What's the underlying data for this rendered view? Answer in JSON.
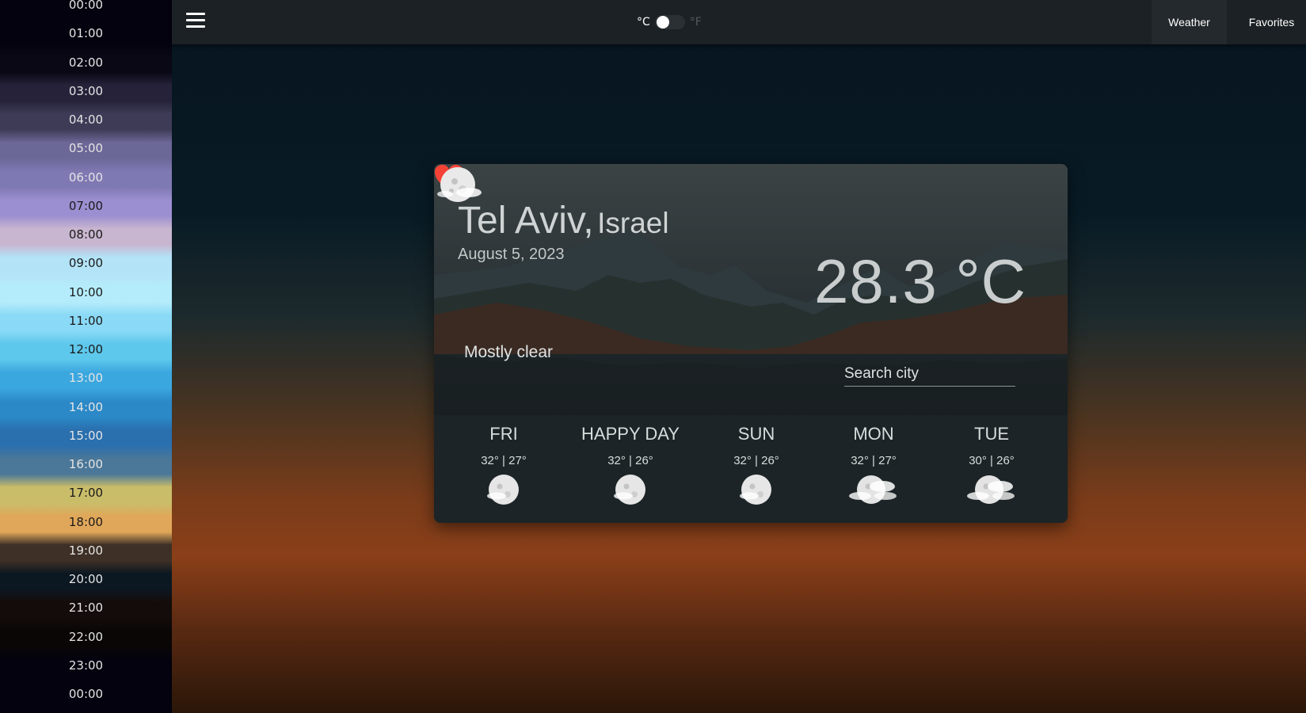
{
  "sidebar": {
    "hours": [
      {
        "label": "00:00",
        "color": "#03020e"
      },
      {
        "label": "01:00",
        "color": "#03020e"
      },
      {
        "label": "02:00",
        "color": "#0a0815"
      },
      {
        "label": "03:00",
        "color": "#26223a"
      },
      {
        "label": "04:00",
        "color": "#3d3b56"
      },
      {
        "label": "05:00",
        "color": "#6b6797"
      },
      {
        "label": "06:00",
        "color": "#7f79b3"
      },
      {
        "label": "07:00",
        "color": "#9b8fd1"
      },
      {
        "label": "08:00",
        "color": "#c8b5cf"
      },
      {
        "label": "09:00",
        "color": "#b3e3f7"
      },
      {
        "label": "10:00",
        "color": "#b4ecfb"
      },
      {
        "label": "11:00",
        "color": "#8ad9f6"
      },
      {
        "label": "12:00",
        "color": "#5ec8ec"
      },
      {
        "label": "13:00",
        "color": "#3ba7df"
      },
      {
        "label": "14:00",
        "color": "#2b89c7"
      },
      {
        "label": "15:00",
        "color": "#2a6fae"
      },
      {
        "label": "16:00",
        "color": "#4b7798"
      },
      {
        "label": "17:00",
        "color": "#c9bd6a"
      },
      {
        "label": "18:00",
        "color": "#e0a75a"
      },
      {
        "label": "19:00",
        "color": "#3e3026"
      },
      {
        "label": "20:00",
        "color": "#0c1821"
      },
      {
        "label": "21:00",
        "color": "#140c0a"
      },
      {
        "label": "22:00",
        "color": "#0a0606"
      },
      {
        "label": "23:00",
        "color": "#03020e"
      },
      {
        "label": "00:00",
        "color": "#03020e"
      }
    ]
  },
  "topbar": {
    "unit_c": "°C",
    "unit_f": "°F",
    "nav": {
      "weather": "Weather",
      "favorites": "Favorites"
    }
  },
  "current": {
    "city": "Tel Aviv,",
    "country": "Israel",
    "date": "August 5, 2023",
    "temperature": "28.3 °C",
    "condition": "Mostly clear",
    "icon": "moon-partly-cloudy-icon",
    "favorite_color": "#f44336"
  },
  "search": {
    "placeholder": "Search city"
  },
  "forecast": [
    {
      "day": "FRI",
      "temps": "32° | 27°",
      "icon": "moon-partly-cloudy-icon"
    },
    {
      "day": "HAPPY DAY",
      "temps": "32° | 26°",
      "icon": "moon-partly-cloudy-icon"
    },
    {
      "day": "SUN",
      "temps": "32° | 26°",
      "icon": "moon-partly-cloudy-icon"
    },
    {
      "day": "MON",
      "temps": "32° | 27°",
      "icon": "moon-cloudy-icon"
    },
    {
      "day": "TUE",
      "temps": "30° | 26°",
      "icon": "moon-cloudy-icon"
    }
  ]
}
